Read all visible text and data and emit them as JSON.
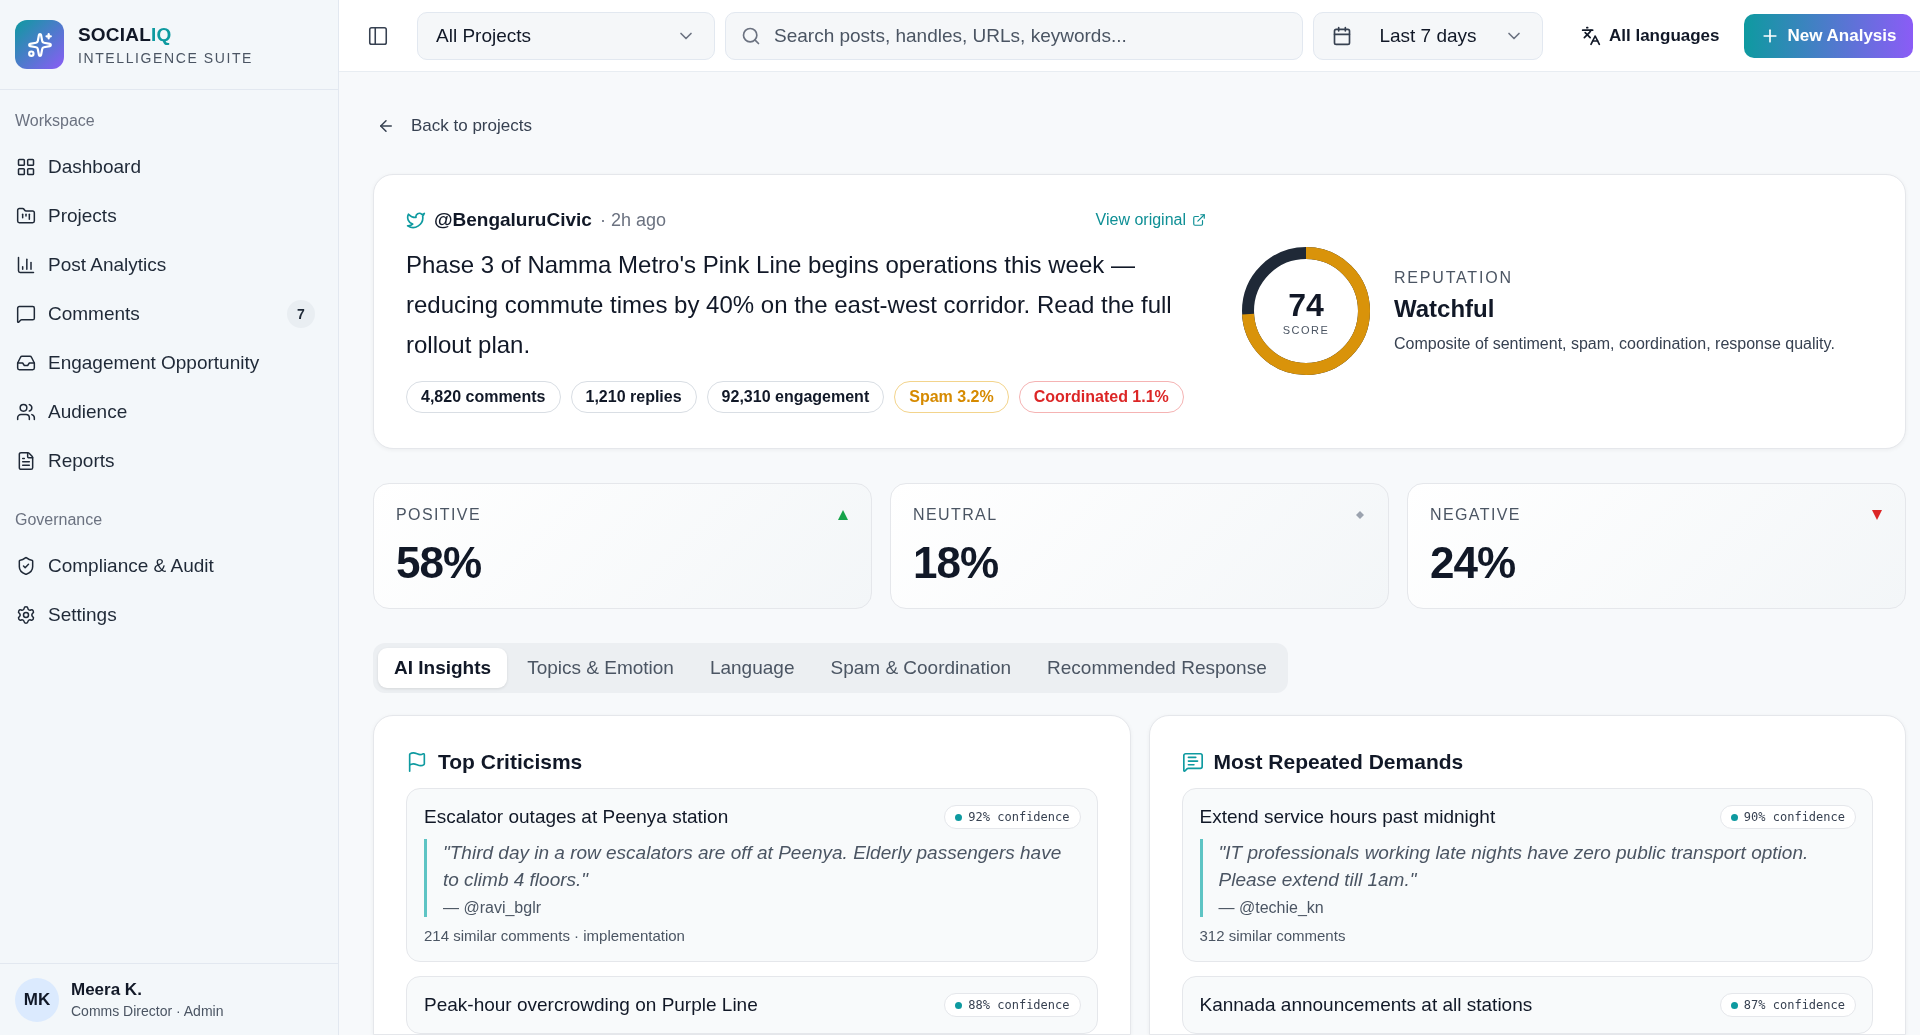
{
  "brand": {
    "name_part_1": "SOCIAL",
    "name_part_2": "IQ",
    "subtitle": "INTELLIGENCE SUITE"
  },
  "sidebar": {
    "sections": [
      {
        "title": "Workspace",
        "items": [
          {
            "label": "Dashboard",
            "selected": false
          },
          {
            "label": "Projects",
            "selected": false
          },
          {
            "label": "Post Analytics",
            "selected": false
          },
          {
            "label": "Comments",
            "selected": false,
            "badge": "7"
          },
          {
            "label": "Engagement Opportunity",
            "selected": false
          },
          {
            "label": "Audience",
            "selected": false
          },
          {
            "label": "Reports",
            "selected": false
          }
        ]
      },
      {
        "title": "Governance",
        "items": [
          {
            "label": "Compliance & Audit",
            "selected": false
          },
          {
            "label": "Settings",
            "selected": false
          }
        ]
      }
    ]
  },
  "user": {
    "initials": "MK",
    "name": "Meera K.",
    "role": "Comms Director · Admin"
  },
  "toolbar": {
    "project_select": "All Projects",
    "search": {
      "placeholder": "Search posts, handles, URLs, keywords..."
    },
    "date_select": "Last 7 days",
    "language": "All languages",
    "new_button": "New Analysis"
  },
  "back_link": "Back to projects",
  "post": {
    "handle": "@BengaluruCivic",
    "time": "· 2h ago",
    "view_link": "View original",
    "text": "Phase 3 of Namma Metro's Pink Line begins operations this week — reducing commute times by 40% on the east-west corridor. Read the full rollout plan.",
    "pills": [
      {
        "label": "4,820 comments",
        "kind": "neutral"
      },
      {
        "label": "1,210 replies",
        "kind": "neutral"
      },
      {
        "label": "92,310 engagement",
        "kind": "neutral"
      },
      {
        "label": "Spam 3.2%",
        "kind": "warning"
      },
      {
        "label": "Coordinated 1.1%",
        "kind": "danger"
      }
    ]
  },
  "reputation": {
    "score": "74",
    "score_label": "SCORE",
    "level": 0.74,
    "label": "REPUTATION",
    "status": "Watchful",
    "description": "Composite of sentiment, spam, coordination, response quality."
  },
  "sentiment": [
    {
      "label": "POSITIVE",
      "value": "58%",
      "kind": "up",
      "color": "#16a34a"
    },
    {
      "label": "NEUTRAL",
      "value": "18%",
      "kind": "flat",
      "color": "#9ca3af"
    },
    {
      "label": "NEGATIVE",
      "value": "24%",
      "kind": "down",
      "color": "#dc2626"
    }
  ],
  "tabs": [
    {
      "label": "AI Insights",
      "selected": true
    },
    {
      "label": "Topics & Emotion",
      "selected": false
    },
    {
      "label": "Language",
      "selected": false
    },
    {
      "label": "Spam & Coordination",
      "selected": false
    },
    {
      "label": "Recommended Response",
      "selected": false
    }
  ],
  "panels": [
    {
      "title": "Top Criticisms",
      "items": [
        {
          "title": "Escalator outages at Peenya station",
          "confidence": "92% confidence",
          "quote": "\"Third day in a row escalators are off at Peenya. Elderly passengers have to climb 4 floors.\"",
          "author": "— @ravi_bglr",
          "meta": "214 similar comments · implementation"
        },
        {
          "title": "Peak-hour overcrowding on Purple Line",
          "confidence": "88% confidence"
        }
      ]
    },
    {
      "title": "Most Repeated Demands",
      "items": [
        {
          "title": "Extend service hours past midnight",
          "confidence": "90% confidence",
          "quote": "\"IT professionals working late nights have zero public transport option. Please extend till 1am.\"",
          "author": "— @techie_kn",
          "meta": "312 similar comments"
        },
        {
          "title": "Kannada announcements at all stations",
          "confidence": "87% confidence"
        }
      ]
    }
  ]
}
